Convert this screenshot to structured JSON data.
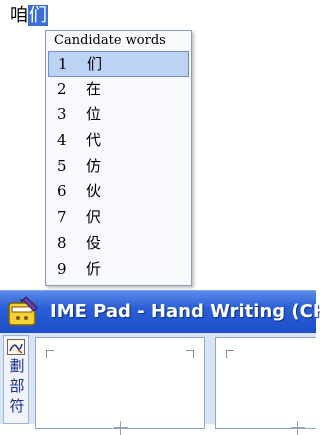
{
  "composition": {
    "committed": "咱",
    "selected": "们"
  },
  "candidate_window": {
    "header": "Candidate words",
    "items": [
      {
        "num": "1",
        "char": "们"
      },
      {
        "num": "2",
        "char": "在"
      },
      {
        "num": "3",
        "char": "位"
      },
      {
        "num": "4",
        "char": "代"
      },
      {
        "num": "5",
        "char": "仿"
      },
      {
        "num": "6",
        "char": "伙"
      },
      {
        "num": "7",
        "char": "伬"
      },
      {
        "num": "8",
        "char": "伇"
      },
      {
        "num": "9",
        "char": "伒"
      }
    ],
    "active_index": 0
  },
  "imepad": {
    "title": "IME Pad - Hand Writing (CH)",
    "side_labels": [
      "劃",
      "部",
      "符"
    ]
  },
  "colors": {
    "titlebar": "#2a5fd6",
    "selection": "#3a6fd8",
    "candidate_highlight": "#bcd3f4"
  }
}
